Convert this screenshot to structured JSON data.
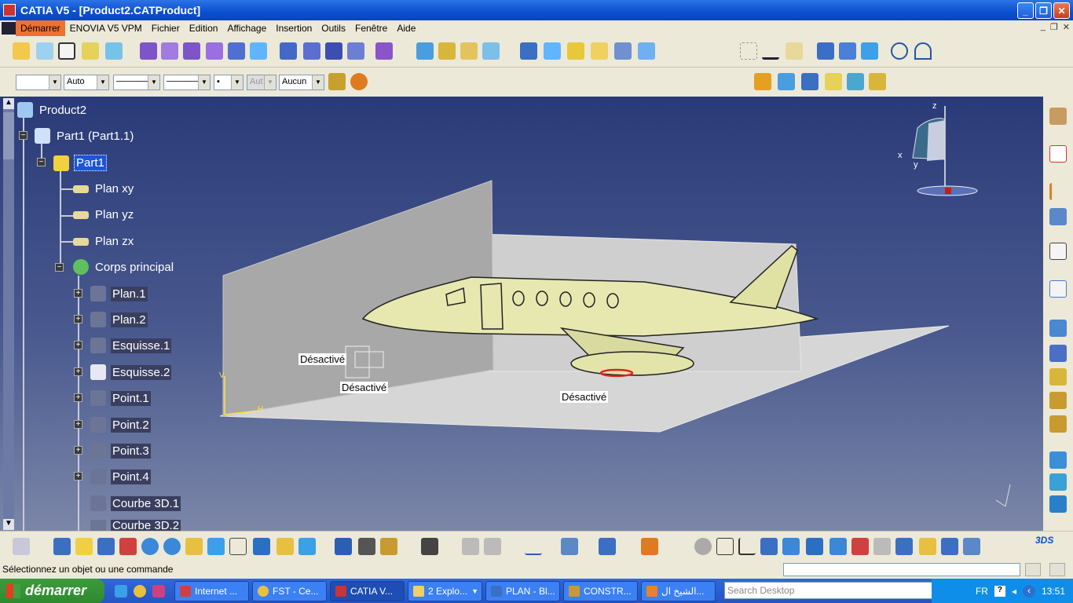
{
  "window": {
    "title": "CATIA V5 - [Product2.CATProduct]"
  },
  "menu": [
    "Démarrer",
    "ENOVIA V5 VPM",
    "Fichier",
    "Edition",
    "Affichage",
    "Insertion",
    "Outils",
    "Fenêtre",
    "Aide"
  ],
  "properties": {
    "color": "",
    "line_auto": "Auto",
    "layer_value": "Aucun",
    "ghost": "Aut"
  },
  "tree": {
    "root": "Product2",
    "part_instance": "Part1 (Part1.1)",
    "part": "Part1",
    "planes": [
      "Plan xy",
      "Plan yz",
      "Plan zx"
    ],
    "body": "Corps principal",
    "features": [
      "Plan.1",
      "Plan.2",
      "Esquisse.1",
      "Esquisse.2",
      "Point.1",
      "Point.2",
      "Point.3",
      "Point.4",
      "Courbe 3D.1",
      "Courbe 3D.2"
    ]
  },
  "viewport": {
    "labels": [
      "Désactivé",
      "Désactivé",
      "Désactivé"
    ],
    "axis": {
      "x": "x",
      "y": "y",
      "z": "z",
      "h": "H",
      "v": "V"
    }
  },
  "status": {
    "message": "Sélectionnez un objet ou une commande"
  },
  "taskbar": {
    "start": "démarrer",
    "tasks": [
      "Internet ...",
      "FST - Ce...",
      "CATIA V...",
      "2 Explo...",
      "PLAN - Bl...",
      "CONSTR...",
      "الشيخ ال..."
    ],
    "search_placeholder": "Search Desktop",
    "lang": "FR",
    "time": "13:51"
  },
  "colors": {
    "accent": "#f07030",
    "viewport_top": "#293a78",
    "model": "#e6e8b0"
  }
}
